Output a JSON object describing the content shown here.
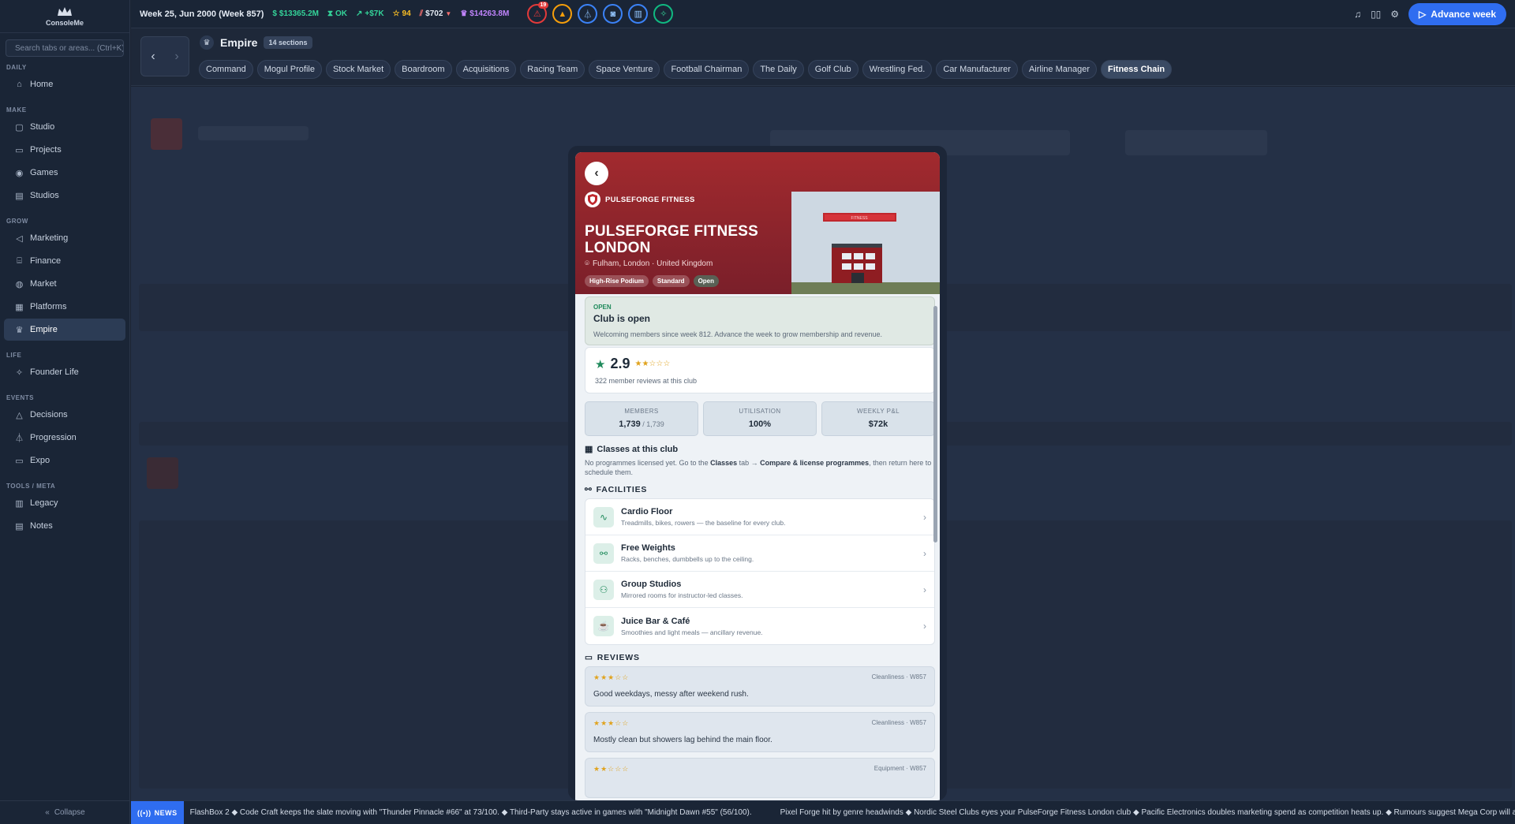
{
  "app": {
    "logo_text": "ConsoleMe"
  },
  "sidebar": {
    "search_placeholder": "Search tabs or areas... (Ctrl+K)",
    "sections": [
      {
        "title": "DAILY",
        "items": [
          {
            "label": "Home",
            "icon": "home-icon"
          }
        ]
      },
      {
        "title": "MAKE",
        "items": [
          {
            "label": "Studio",
            "icon": "studio-icon"
          },
          {
            "label": "Projects",
            "icon": "folder-icon"
          },
          {
            "label": "Games",
            "icon": "gamepad-icon"
          },
          {
            "label": "Studios",
            "icon": "building-icon"
          }
        ]
      },
      {
        "title": "GROW",
        "items": [
          {
            "label": "Marketing",
            "icon": "megaphone-icon"
          },
          {
            "label": "Finance",
            "icon": "bank-icon"
          },
          {
            "label": "Market",
            "icon": "globe-icon"
          },
          {
            "label": "Platforms",
            "icon": "grid-icon"
          },
          {
            "label": "Empire",
            "icon": "crown-icon",
            "active": true
          }
        ]
      },
      {
        "title": "LIFE",
        "items": [
          {
            "label": "Founder Life",
            "icon": "sparkles-icon"
          }
        ]
      },
      {
        "title": "EVENTS",
        "items": [
          {
            "label": "Decisions",
            "icon": "alert-icon"
          },
          {
            "label": "Progression",
            "icon": "flask-icon"
          },
          {
            "label": "Expo",
            "icon": "monitor-icon"
          }
        ]
      },
      {
        "title": "TOOLS / META",
        "items": [
          {
            "label": "Legacy",
            "icon": "film-icon"
          },
          {
            "label": "Notes",
            "icon": "notes-icon"
          }
        ]
      }
    ],
    "collapse_label": "Collapse"
  },
  "topbar": {
    "week": "Week 25, Jun 2000 (Week 857)",
    "cash": "$13365.2M",
    "status": "OK",
    "delta": "+$7K",
    "rating": "94",
    "price": "$702",
    "valuation": "$14263.8M",
    "alert_badge": "19",
    "advance_label": "Advance week",
    "colors": {
      "cash": "#34d399",
      "delta": "#34d399",
      "rating": "#fbbf24",
      "price": "#f87171",
      "valuation": "#c084fc"
    }
  },
  "empire": {
    "title": "Empire",
    "sections_badge": "14 sections",
    "tabs": [
      "Command",
      "Mogul Profile",
      "Stock Market",
      "Boardroom",
      "Acquisitions",
      "Racing Team",
      "Space Venture",
      "Football Chairman",
      "The Daily",
      "Golf Club",
      "Wrestling Fed.",
      "Car Manufacturer",
      "Airline Manager",
      "Fitness Chain"
    ],
    "active_tab": "Fitness Chain"
  },
  "club": {
    "brand": "PULSEFORGE FITNESS",
    "name": "PULSEFORGE FITNESS LONDON",
    "location": "Fulham, London · United Kingdom",
    "chips": [
      "High-Rise Podium",
      "Standard",
      "Open"
    ],
    "sign_text": "FITNESS",
    "status_label": "OPEN",
    "status_title": "Club is open",
    "status_desc": "Welcoming members since week 812. Advance the week to grow membership and revenue.",
    "rating": "2.9",
    "rating_stars": "★★☆☆☆",
    "review_count": "322 member reviews at this club",
    "stats": [
      {
        "label": "MEMBERS",
        "value": "1,739",
        "sub": " / 1,739"
      },
      {
        "label": "UTILISATION",
        "value": "100%",
        "sub": ""
      },
      {
        "label": "WEEKLY P&L",
        "value": "$72k",
        "sub": ""
      }
    ],
    "classes_title": "Classes at this club",
    "classes_text_a": "No programmes licensed yet. Go to the ",
    "classes_text_b": "Classes",
    "classes_text_c": " tab → ",
    "classes_text_d": "Compare & license programmes",
    "classes_text_e": ", then return here to schedule them.",
    "facilities_title": "FACILITIES",
    "facilities": [
      {
        "name": "Cardio Floor",
        "desc": "Treadmills, bikes, rowers — the baseline for every club.",
        "icon": "pulse-icon"
      },
      {
        "name": "Free Weights",
        "desc": "Racks, benches, dumbbells up to the ceiling.",
        "icon": "dumbbell-icon"
      },
      {
        "name": "Group Studios",
        "desc": "Mirrored rooms for instructor-led classes.",
        "icon": "users-icon"
      },
      {
        "name": "Juice Bar & Café",
        "desc": "Smoothies and light meals — ancillary revenue.",
        "icon": "cup-icon"
      }
    ],
    "reviews_title": "REVIEWS",
    "reviews": [
      {
        "stars": "★★★☆☆",
        "meta": "Cleanliness · W857",
        "text": "Good weekdays, messy after weekend rush."
      },
      {
        "stars": "★★★☆☆",
        "meta": "Cleanliness · W857",
        "text": "Mostly clean but showers lag behind the main floor."
      },
      {
        "stars": "★★☆☆☆",
        "meta": "Equipment · W857",
        "text": ""
      }
    ]
  },
  "news": {
    "tag": "NEWS",
    "items": [
      "FlashBox 2 ◆ Code Craft keeps the slate moving with \"Thunder Pinnacle #66\" at 73/100. ◆ Third-Party stays active in games with \"Midnight Dawn #55\" (56/100).",
      "Pixel Forge hit by genre headwinds ◆ Nordic Steel Clubs eyes your PulseForge Fitness London club ◆ Pacific Electronics doubles marketing spend as competition heats up. ◆ Rumours suggest Mega Corp will announce a next-gen t"
    ]
  }
}
